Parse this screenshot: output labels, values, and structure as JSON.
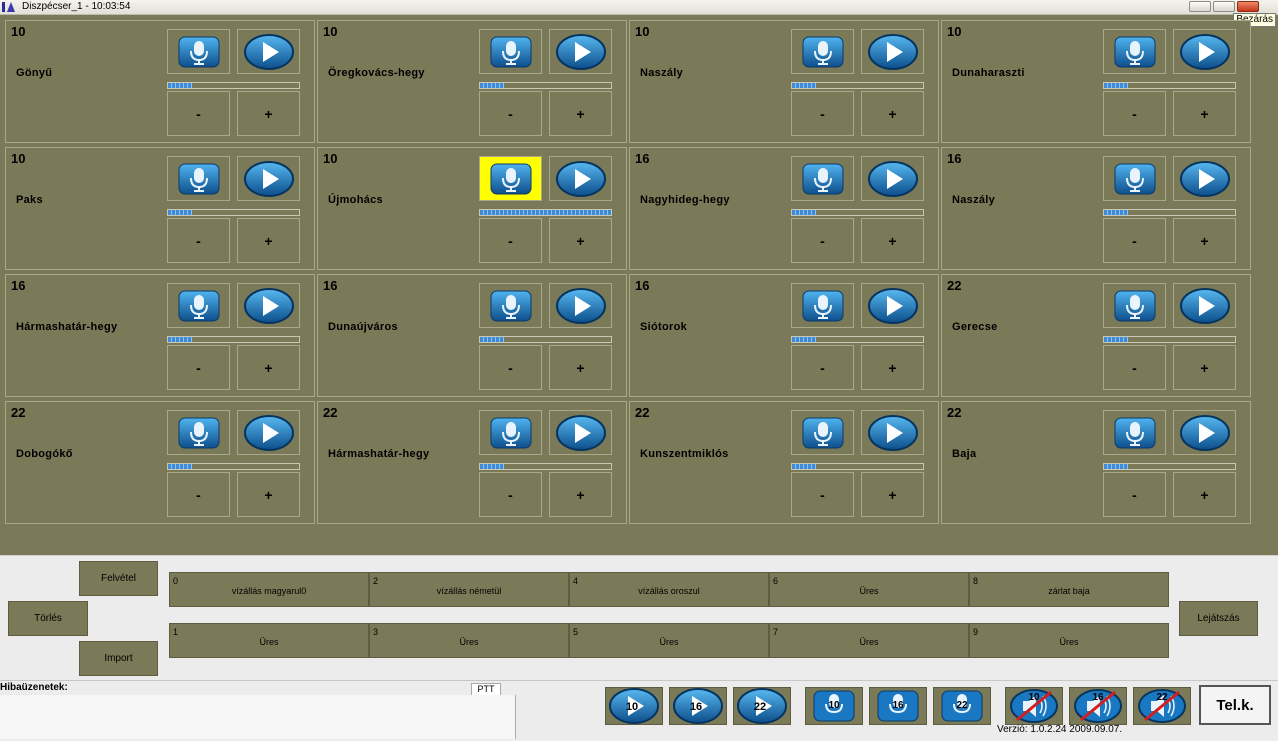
{
  "window": {
    "title": "Diszpécser_1 - 10:03:54",
    "tooltip": "Bezárás"
  },
  "colors": {
    "panel": "#7b7a58",
    "active": "#ffff00",
    "meter": "#3d8ad6"
  },
  "icons": {
    "mic": "microphone-icon",
    "play": "play-icon"
  },
  "tiles": [
    {
      "num": "10",
      "name": "Gönyű",
      "level": 0.18,
      "active": false
    },
    {
      "num": "10",
      "name": "Öregkovács-hegy",
      "level": 0.18,
      "active": false
    },
    {
      "num": "10",
      "name": "Naszály",
      "level": 0.18,
      "active": false
    },
    {
      "num": "10",
      "name": "Dunaharaszti",
      "level": 0.18,
      "active": false
    },
    {
      "num": "10",
      "name": "Paks",
      "level": 0.18,
      "active": false
    },
    {
      "num": "10",
      "name": "Újmohács",
      "level": 1.0,
      "active": true
    },
    {
      "num": "16",
      "name": "Nagyhideg-hegy",
      "level": 0.18,
      "active": false
    },
    {
      "num": "16",
      "name": "Naszály",
      "level": 0.18,
      "active": false
    },
    {
      "num": "16",
      "name": "Hármashatár-hegy",
      "level": 0.18,
      "active": false
    },
    {
      "num": "16",
      "name": "Dunaújváros",
      "level": 0.18,
      "active": false
    },
    {
      "num": "16",
      "name": "Siótorok",
      "level": 0.18,
      "active": false
    },
    {
      "num": "22",
      "name": "Gerecse",
      "level": 0.18,
      "active": false
    },
    {
      "num": "22",
      "name": "Dobogókő",
      "level": 0.18,
      "active": false
    },
    {
      "num": "22",
      "name": "Hármashatár-hegy",
      "level": 0.18,
      "active": false
    },
    {
      "num": "22",
      "name": "Kunszentmiklós",
      "level": 0.18,
      "active": false
    },
    {
      "num": "22",
      "name": "Baja",
      "level": 0.18,
      "active": false
    }
  ],
  "tile_labels": {
    "minus": "-",
    "plus": "+"
  },
  "recorder": {
    "record": "Felvétel",
    "delete": "Törlés",
    "import": "Import",
    "playback": "Lejátszás"
  },
  "slots": [
    {
      "idx": "0",
      "label": "vízállás magyarul0"
    },
    {
      "idx": "2",
      "label": "vízállás németül"
    },
    {
      "idx": "4",
      "label": "vízállás oroszul"
    },
    {
      "idx": "6",
      "label": "Üres"
    },
    {
      "idx": "8",
      "label": "zárlat baja"
    },
    {
      "idx": "1",
      "label": "Üres"
    },
    {
      "idx": "3",
      "label": "Üres"
    },
    {
      "idx": "5",
      "label": "Üres"
    },
    {
      "idx": "7",
      "label": "Üres"
    },
    {
      "idx": "9",
      "label": "Üres"
    }
  ],
  "status": {
    "errors_label": "Hibaüzenetek:",
    "ptt": "PTT",
    "version": "Verzió: 1.0.2.24 2009.09.07."
  },
  "controls": {
    "play": [
      "10",
      "16",
      "22"
    ],
    "mic": [
      "10",
      "16",
      "22"
    ],
    "mute": [
      "10",
      "16",
      "22"
    ],
    "telk": "Tel.k."
  }
}
